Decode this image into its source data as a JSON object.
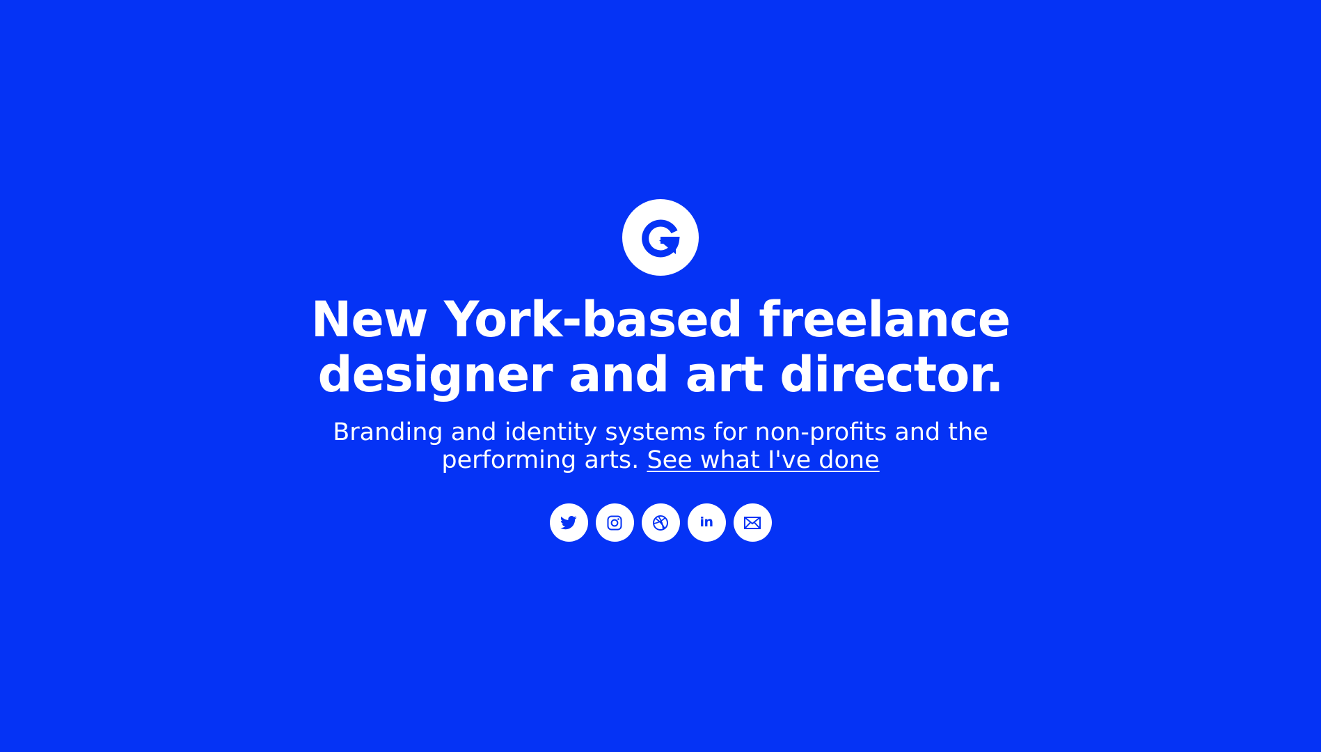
{
  "brand": {
    "logo_icon": "g-logo-icon",
    "background_color": "#0533F5",
    "foreground_color": "#ffffff"
  },
  "hero": {
    "headline_line1": "New York-based freelance",
    "headline_line2": "designer and art director.",
    "subline_line1": "Branding and identity systems for non-profits and the",
    "subline_line2_prefix": "performing arts.",
    "work_link_label": "See what I've done"
  },
  "social": [
    {
      "icon": "twitter-icon"
    },
    {
      "icon": "instagram-icon"
    },
    {
      "icon": "dribbble-icon"
    },
    {
      "icon": "linkedin-icon",
      "label": "in"
    },
    {
      "icon": "email-icon"
    }
  ]
}
